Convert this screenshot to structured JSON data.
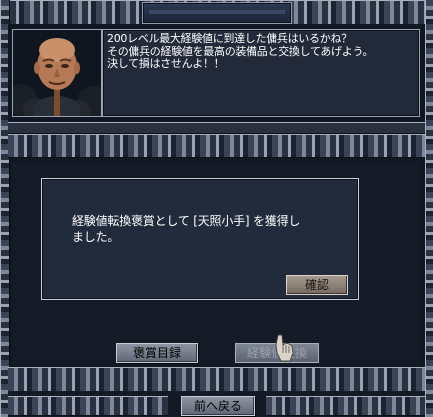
{
  "npc_dialog": {
    "text": "200レベル最大経験値に到達した傭兵はいるかね？\nその傭兵の経験値を最高の装備品と交換してあげよう。\n決して損はさせんよ！！"
  },
  "popup": {
    "message": "経験値転換褒賞として [天照小手] を獲得し\nました。",
    "confirm_label": "確認"
  },
  "buttons": {
    "rewards_list": "褒賞目録",
    "exchange": "経験値交換",
    "back": "前へ戻る"
  },
  "icons": {
    "portrait": "npc-portrait-icon",
    "cursor": "gauntlet-cursor-icon"
  },
  "colors": {
    "panel": "#222a3a",
    "border": "#9aa3b3",
    "confirm_button": "#a49a8e"
  }
}
